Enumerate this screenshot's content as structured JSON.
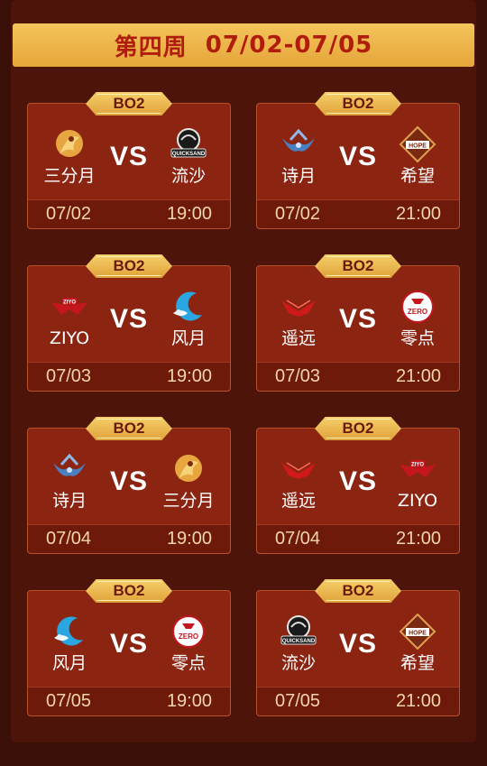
{
  "header": {
    "week": "第四周",
    "range": "07/02-07/05"
  },
  "matches": [
    {
      "badge": "BO2",
      "left": {
        "name": "三分月",
        "logo": "sanfenyue-logo"
      },
      "vs": "VS",
      "right": {
        "name": "流沙",
        "logo": "quicksand-logo"
      },
      "date": "07/02",
      "time": "19:00"
    },
    {
      "badge": "BO2",
      "left": {
        "name": "诗月",
        "logo": "shiyue-logo"
      },
      "vs": "VS",
      "right": {
        "name": "希望",
        "logo": "hope-logo"
      },
      "date": "07/02",
      "time": "21:00"
    },
    {
      "badge": "BO2",
      "left": {
        "name": "ZIYO",
        "logo": "ziyo-logo"
      },
      "vs": "VS",
      "right": {
        "name": "风月",
        "logo": "fengyue-logo"
      },
      "date": "07/03",
      "time": "19:00"
    },
    {
      "badge": "BO2",
      "left": {
        "name": "遥远",
        "logo": "yaoyuan-logo"
      },
      "vs": "VS",
      "right": {
        "name": "零点",
        "logo": "zero-logo"
      },
      "date": "07/03",
      "time": "21:00"
    },
    {
      "badge": "BO2",
      "left": {
        "name": "诗月",
        "logo": "shiyue-logo"
      },
      "vs": "VS",
      "right": {
        "name": "三分月",
        "logo": "sanfenyue-logo"
      },
      "date": "07/04",
      "time": "19:00"
    },
    {
      "badge": "BO2",
      "left": {
        "name": "遥远",
        "logo": "yaoyuan-logo"
      },
      "vs": "VS",
      "right": {
        "name": "ZIYO",
        "logo": "ziyo-logo"
      },
      "date": "07/04",
      "time": "21:00"
    },
    {
      "badge": "BO2",
      "left": {
        "name": "风月",
        "logo": "fengyue-logo"
      },
      "vs": "VS",
      "right": {
        "name": "零点",
        "logo": "zero-logo"
      },
      "date": "07/05",
      "time": "19:00"
    },
    {
      "badge": "BO2",
      "left": {
        "name": "流沙",
        "logo": "quicksand-logo"
      },
      "vs": "VS",
      "right": {
        "name": "希望",
        "logo": "hope-logo"
      },
      "date": "07/05",
      "time": "21:00"
    }
  ],
  "logo_text": {
    "ziyo": "ZIYO",
    "hope": "HOPE",
    "zero": "ZERO",
    "quicksand": "QUICKSAND"
  },
  "colors": {
    "background": "#4d1409",
    "card": "#8b2512",
    "header": "#f0b94e",
    "header_text": "#b01d0c",
    "badge": "#f0bf55",
    "footer_text": "#f2d6a8"
  }
}
